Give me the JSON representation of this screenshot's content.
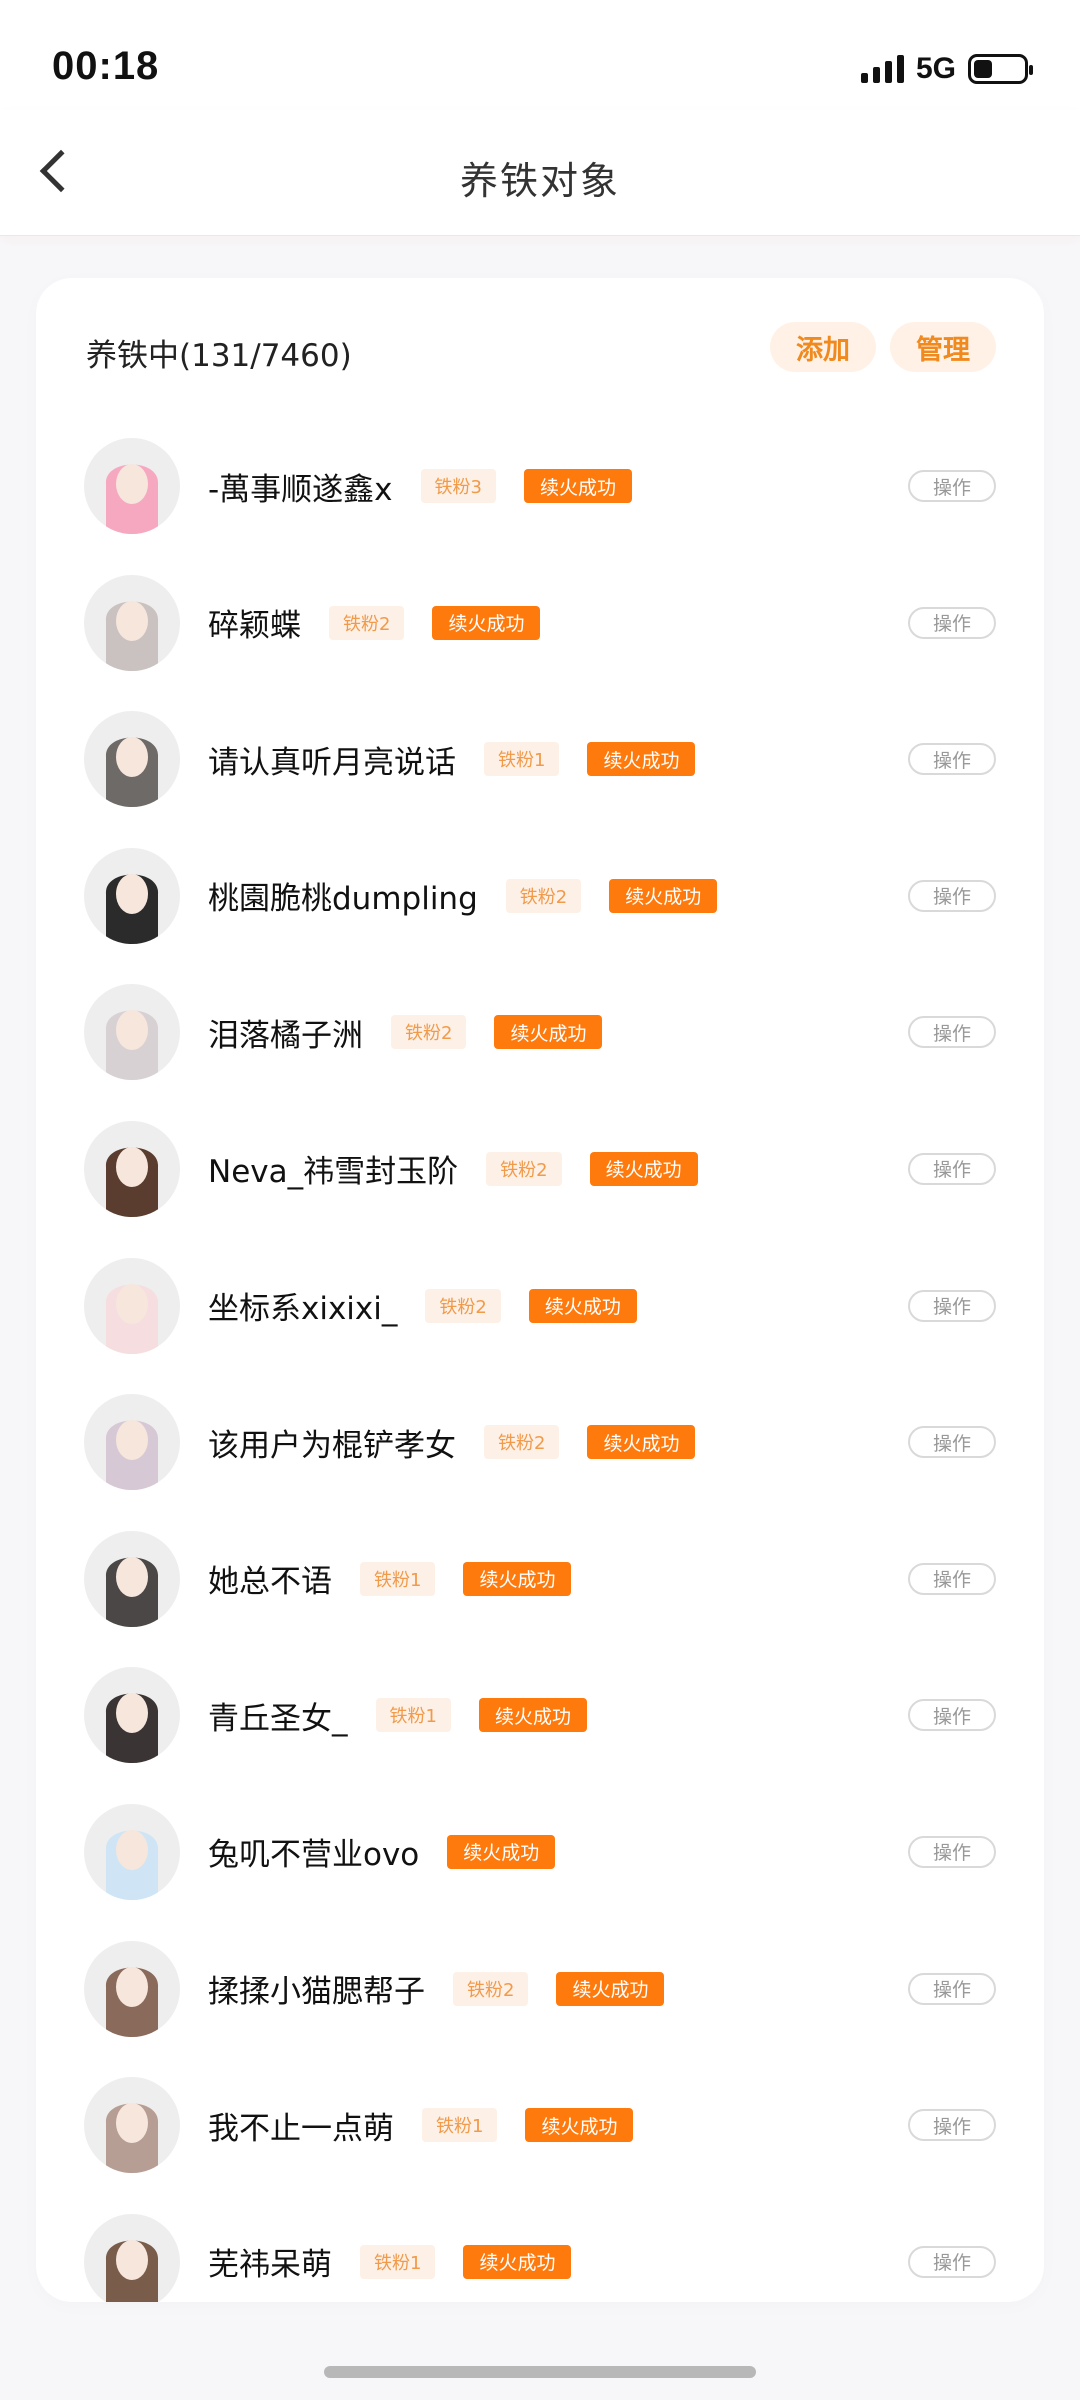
{
  "status": {
    "time": "00:18",
    "network": "5G"
  },
  "nav": {
    "title": "养铁对象"
  },
  "card": {
    "title": "养铁中(131/7460)",
    "add_label": "添加",
    "manage_label": "管理",
    "op_label": "操作",
    "fire_label": "续火成功"
  },
  "rows": [
    {
      "name": "-萬事顺遂鑫x",
      "fan": "铁粉3",
      "avatar_color": "#f6a8c1"
    },
    {
      "name": "碎颖蝶",
      "fan": "铁粉2",
      "avatar_color": "#c9c2c0"
    },
    {
      "name": "请认真听月亮说话",
      "fan": "铁粉1",
      "avatar_color": "#6e6a68"
    },
    {
      "name": "桃園脆桃dumpling",
      "fan": "铁粉2",
      "avatar_color": "#2b2b2b"
    },
    {
      "name": "泪落橘子洲",
      "fan": "铁粉2",
      "avatar_color": "#d8d1d4"
    },
    {
      "name": "Neva_祎雪封玉阶",
      "fan": "铁粉2",
      "avatar_color": "#5a3d2e"
    },
    {
      "name": "坐标系xixixi_",
      "fan": "铁粉2",
      "avatar_color": "#f6dde0"
    },
    {
      "name": "该用户为棍铲孝女",
      "fan": "铁粉2",
      "avatar_color": "#d7c8d6"
    },
    {
      "name": "她总不语",
      "fan": "铁粉1",
      "avatar_color": "#4a4746"
    },
    {
      "name": "青丘圣女_",
      "fan": "铁粉1",
      "avatar_color": "#3a3434"
    },
    {
      "name": "兔叽不营业ovo",
      "fan": "",
      "avatar_color": "#cfe5f5"
    },
    {
      "name": "揉揉小猫腮帮子",
      "fan": "铁粉2",
      "avatar_color": "#8a6a5a"
    },
    {
      "name": "我不止一点萌",
      "fan": "铁粉1",
      "avatar_color": "#b79e94"
    },
    {
      "name": "芜祎呆萌",
      "fan": "铁粉1",
      "avatar_color": "#7a5c4a"
    }
  ]
}
